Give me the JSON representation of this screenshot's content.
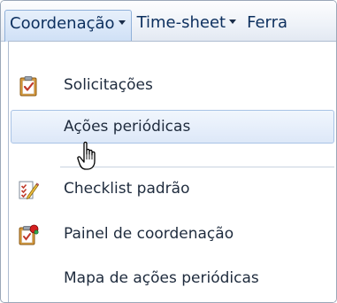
{
  "menubar": {
    "items": [
      {
        "label": "Coordenação"
      },
      {
        "label": "Time-sheet"
      },
      {
        "label": "Ferra"
      }
    ]
  },
  "dropdown": {
    "items": [
      {
        "label": "Solicitações",
        "icon": "clipboard-check-icon"
      },
      {
        "label": "Ações periódicas",
        "icon": ""
      },
      {
        "label": "Checklist padrão",
        "icon": "checklist-pencil-icon"
      },
      {
        "label": "Painel de coordenação",
        "icon": "clipboard-red-flag-icon"
      },
      {
        "label": "Mapa de ações periódicas",
        "icon": ""
      }
    ]
  },
  "colors": {
    "menu_text": "#0c2f5e",
    "item_text": "#1e2b3d",
    "hover_border": "#a9c3e6",
    "hover_fill": "#dde8f8"
  }
}
